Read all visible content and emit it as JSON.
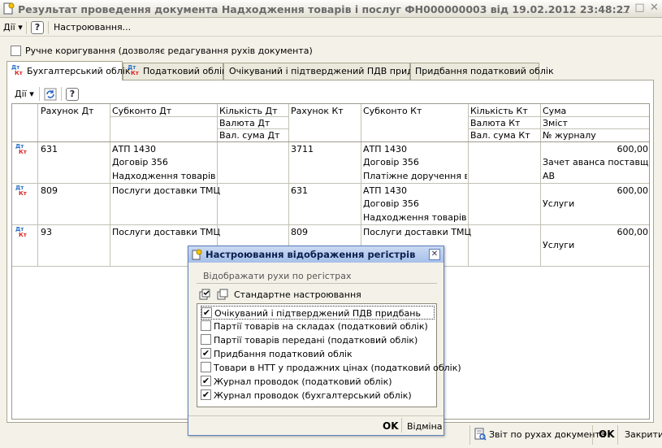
{
  "window": {
    "title": "Результат проведення документа Надходження товарів і послуг ФН000000003 від 19.02.2012 23:48:27"
  },
  "menu": {
    "actions": "Дії",
    "help": "?",
    "settings": "Настроювання..."
  },
  "manual": {
    "label": "Ручне коригування (дозволяє редагування рухів документа)",
    "checked": false
  },
  "tabs": [
    {
      "label": "Бухгалтерський облік",
      "active": true
    },
    {
      "label": "Податковий облік",
      "active": false
    },
    {
      "label": "Очікуваний і підтверджений ПДВ придбань",
      "active": false
    },
    {
      "label": "Придбання податковий облік",
      "active": false
    }
  ],
  "tab_icons": {
    "dt": "Дт",
    "kt": "Кт"
  },
  "toolbar": {
    "actions": "Дії",
    "help": "?"
  },
  "table": {
    "headers": {
      "acc_dt": "Рахунок Дт",
      "sub_dt": "Субконто Дт",
      "qty_dt": "Кількість Дт",
      "cur_dt": "Валюта Дт",
      "valsum_dt": "Вал. сума Дт",
      "acc_kt": "Рахунок Кт",
      "sub_kt": "Субконто Кт",
      "qty_kt": "Кількість Кт",
      "cur_kt": "Валюта Кт",
      "valsum_kt": "Вал. сума Кт",
      "sum": "Сума",
      "content": "Зміст",
      "journal": "№ журналу"
    },
    "rows": [
      {
        "acc_dt": "631",
        "sub_dt": [
          "АТП 1430",
          "Договір 356",
          "Надходження товарів і ..."
        ],
        "acc_kt": "3711",
        "sub_kt": [
          "АТП 1430",
          "Договір 356",
          "Платіжне доручення ви..."
        ],
        "sum": "600,00",
        "content": "Зачет аванса поставщ...",
        "journal": "АВ"
      },
      {
        "acc_dt": "809",
        "sub_dt": [
          "Послуги доставки ТМЦ",
          "",
          ""
        ],
        "acc_kt": "631",
        "sub_kt": [
          "АТП 1430",
          "Договір 356",
          "Надходження товарів і ..."
        ],
        "sum": "600,00",
        "content": "Услуги",
        "journal": ""
      },
      {
        "acc_dt": "93",
        "sub_dt": [
          "Послуги доставки ТМЦ",
          "",
          ""
        ],
        "acc_kt": "809",
        "sub_kt": [
          "Послуги доставки ТМЦ",
          "",
          ""
        ],
        "sum": "600,00",
        "content": "Услуги",
        "journal": ""
      }
    ]
  },
  "dialog": {
    "title": "Настроювання відображення регістрів",
    "group": "Відображати рухи по регістрах",
    "standard": "Стандартне настроювання",
    "items": [
      {
        "label": "Очікуваний і підтверджений ПДВ придбань",
        "checked": true
      },
      {
        "label": "Партії товарів на складах (податковий облік)",
        "checked": false
      },
      {
        "label": "Партії товарів передані (податковий облік)",
        "checked": false
      },
      {
        "label": "Придбання податковий облік",
        "checked": true
      },
      {
        "label": "Товари в НТТ у продажних цінах (податковий облік)",
        "checked": false
      },
      {
        "label": "Журнал проводок (податковий облік)",
        "checked": true
      },
      {
        "label": "Журнал проводок (бухгалтерський облік)",
        "checked": true
      }
    ],
    "ok": "OK",
    "cancel": "Відміна"
  },
  "status": {
    "report": "Звіт по рухах документа",
    "ok": "OK",
    "close": "Закрити"
  }
}
